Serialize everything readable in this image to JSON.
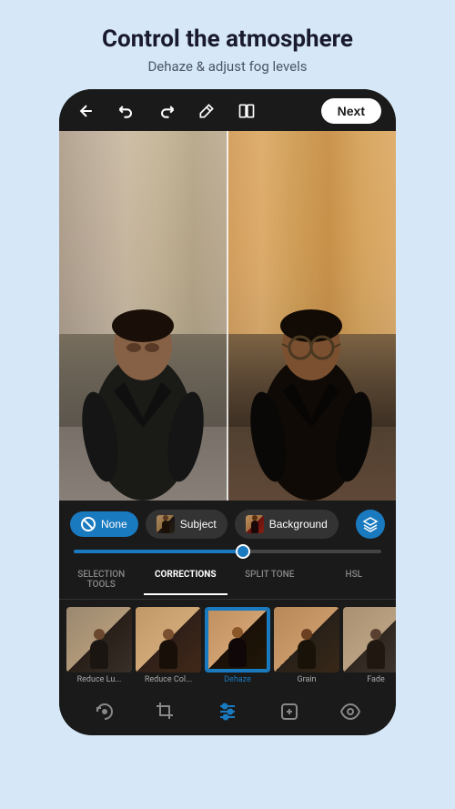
{
  "header": {
    "title": "Control the atmosphere",
    "subtitle": "Dehaze & adjust fog levels"
  },
  "toolbar": {
    "back_icon": "←",
    "undo_icon": "↺",
    "redo_icon": "↻",
    "magic_icon": "✦",
    "compare_icon": "⧉",
    "next_label": "Next"
  },
  "selection_bar": {
    "none_label": "None",
    "subject_label": "Subject",
    "background_label": "Background",
    "slider_value": 55
  },
  "tabs": [
    {
      "id": "selection-tools",
      "label": "SELECTION TOOLS",
      "active": false
    },
    {
      "id": "corrections",
      "label": "CORRECTIONS",
      "active": true
    },
    {
      "id": "split-tone",
      "label": "SPLIT TONE",
      "active": false
    },
    {
      "id": "hsl",
      "label": "HSL",
      "active": false
    }
  ],
  "tools": [
    {
      "id": "reduce-lu",
      "label": "Reduce Lu...",
      "active": false
    },
    {
      "id": "reduce-col",
      "label": "Reduce Col...",
      "active": false
    },
    {
      "id": "dehaze",
      "label": "Dehaze",
      "active": true
    },
    {
      "id": "grain",
      "label": "Grain",
      "active": false
    },
    {
      "id": "fade",
      "label": "Fade",
      "active": false
    }
  ],
  "bottom_toolbar": {
    "icons": [
      "camera-rotate-icon",
      "crop-icon",
      "sliders-icon",
      "healing-icon",
      "eye-icon"
    ]
  }
}
